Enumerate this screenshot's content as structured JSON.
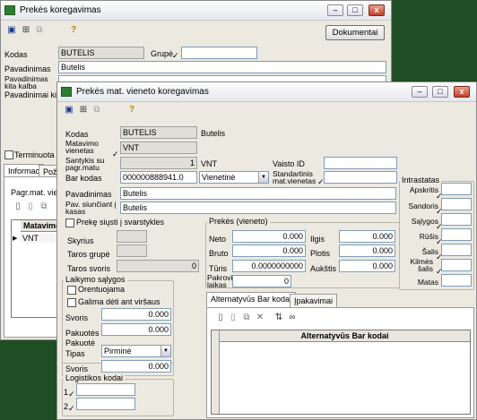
{
  "back": {
    "title": "Prekės koregavimas",
    "documents_button": "Dokumentai",
    "kodas_label": "Kodas",
    "kodas_value": "BUTELIS",
    "grupe_label": "Grupė",
    "pavadinimas_label": "Pavadinimas",
    "pavadinimas_value": "Butelis",
    "pav_kita_kalba_label": "Pavadinimas kita kalba",
    "pavadinimai_k_label": "Pavadinimai ki",
    "terminuota_label": "Terminuota",
    "tab1": "Informac",
    "tab2": "Požy",
    "pagr_label": "Pagr.mat. viene",
    "grid_header": "Matavimo",
    "grid_cell": "VNT"
  },
  "front": {
    "title": "Prekės mat. vieneto koregavimas",
    "kodas_label": "Kodas",
    "kodas_value": "BUTELIS",
    "kodas_name": "Butelis",
    "matavimo_label": "Matavimo vienetas",
    "matavimo_value": "VNT",
    "santykis_label": "Santykis su pagr.matu",
    "santykis_value": "1",
    "santykis_unit": "VNT",
    "vaisto_label": "Vaisto ID",
    "barkodas_label": "Bar kodas",
    "barkodas_value": "000000888941.0",
    "barkodas_type": "Vienetinė",
    "standartinis_label": "Standartinis mat.vienetas",
    "pavadinimas_label": "Pavadinimas",
    "pavadinimas_value": "Butelis",
    "pav_siunciant_label": "Pav. siunčiant į kasas",
    "pav_siunciant_value": "Butelis",
    "preke_siusti_label": "Prekę siųsti į svarstykles",
    "skyrius_label": "Skyrius",
    "taros_grupe_label": "Taros grupė",
    "taros_svoris_label": "Taros svoris",
    "taros_svoris_value": "0",
    "laikymo_title": "Laikymo sąlygos",
    "orientuojama_label": "Orentuojama",
    "galima_label": "Galima dėti ant viršaus",
    "svoris_label": "Svoris",
    "svoris_value": "0.000",
    "pakuotes_label": "Pakuotės",
    "pakuotes_value": "0.000",
    "pakuote_title": "Pakuotė",
    "tipas_label": "Tipas",
    "tipas_value": "Pirminė",
    "pak_svoris_label": "Svoris",
    "pak_svoris_value": "0.000",
    "logistikos_title": "Logistikos kodai",
    "log1": "1",
    "log2": "2",
    "prekes_title": "Prekės (vieneto)",
    "neto_label": "Neto",
    "neto_value": "0.000",
    "bruto_label": "Bruto",
    "bruto_value": "0.000",
    "turis_label": "Tūris",
    "turis_value": "0.0000000000",
    "pakrovimo_label": "Pakrovimo laikas",
    "pakrovimo_value": "0",
    "ilgis_label": "Ilgis",
    "ilgis_value": "0.000",
    "plotis_label": "Plotis",
    "plotis_value": "0.000",
    "aukstis_label": "Aukštis",
    "aukstis_value": "0.000",
    "intrastatas_title": "Intrastatas",
    "intra_labels": [
      "Apskritis",
      "Sandoris",
      "Sąlygos",
      "Rūšis",
      "Šalis",
      "Kilmės šalis",
      "Matas"
    ],
    "tab_alt": "Alternatyvūs Bar kodai",
    "tab_ipak": "Įpakavimai",
    "alt_header": "Alternatyvūs Bar kodai"
  }
}
